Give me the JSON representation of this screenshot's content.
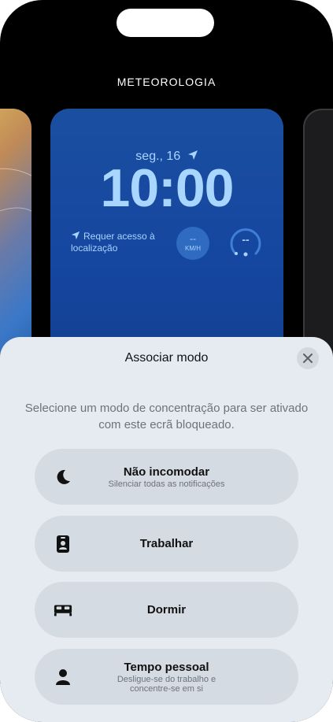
{
  "category": "METEOROLOGIA",
  "lockscreen": {
    "date": "seg., 16",
    "time": "10:00",
    "location_notice": "Requer acesso à localização",
    "wind_value": "--",
    "wind_unit": "KM/H",
    "uv_value": "--"
  },
  "sheet": {
    "title": "Associar modo",
    "description": "Selecione um modo de concentração para ser ativado com este ecrã bloqueado.",
    "modes": [
      {
        "name": "Não incomodar",
        "subtitle": "Silenciar todas as notificações",
        "icon": "moon-icon"
      },
      {
        "name": "Trabalhar",
        "subtitle": "",
        "icon": "badge-icon"
      },
      {
        "name": "Dormir",
        "subtitle": "",
        "icon": "bed-icon"
      },
      {
        "name": "Tempo pessoal",
        "subtitle": "Desligue-se do trabalho e concentre-se em si",
        "icon": "person-icon"
      }
    ]
  },
  "colors": {
    "sheet_bg": "#e6ebf2",
    "mode_bg": "#d5dbe3",
    "wallpaper_blue": "#1546a0",
    "clock_text": "#a8d6ff"
  }
}
